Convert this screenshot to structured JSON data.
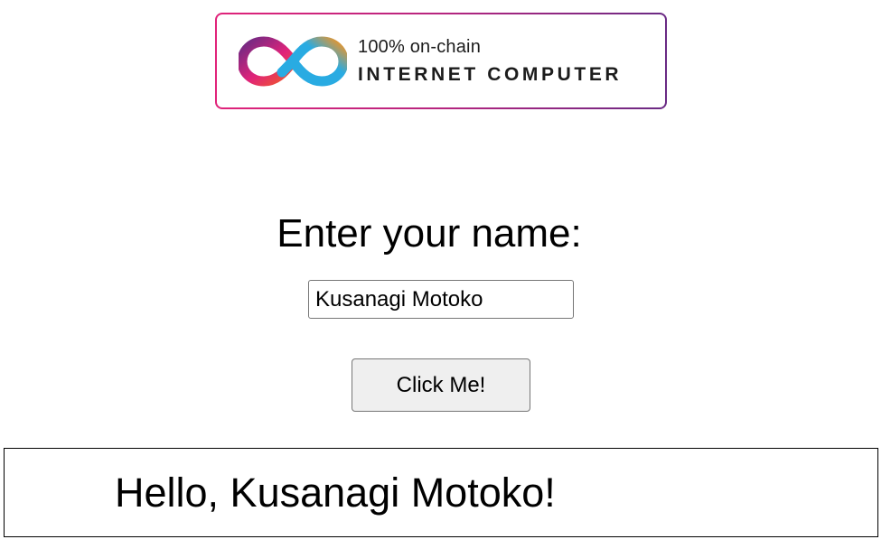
{
  "logo": {
    "tagline": "100% on-chain",
    "name": "INTERNET COMPUTER",
    "icon": "infinity-logo-icon",
    "colors": {
      "left_start": "#6a2a84",
      "left_mid": "#e0237a",
      "right_start": "#29abe2",
      "right_end": "#f7931e",
      "border_start": "#e0237a",
      "border_end": "#6a2a84"
    }
  },
  "form": {
    "prompt": "Enter your name:",
    "name_value": "Kusanagi Motoko",
    "button_label": "Click Me!"
  },
  "result": {
    "greeting": "Hello, Kusanagi Motoko!"
  }
}
